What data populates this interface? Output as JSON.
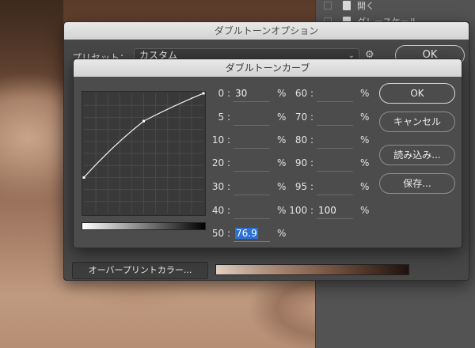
{
  "side_panel": {
    "rows": [
      {
        "label": "開く"
      },
      {
        "label": "グレースケール"
      }
    ]
  },
  "outer_dialog": {
    "title": "ダブルトーンオプション",
    "preset_label": "プリセット：",
    "preset_value": "カスタム",
    "ok_label": "OK",
    "overprint_label": "オーバープリントカラー..."
  },
  "curve_dialog": {
    "title": "ダブルトーンカーブ",
    "fields_left": [
      {
        "label": "0 :",
        "value": "30"
      },
      {
        "label": "5 :",
        "value": ""
      },
      {
        "label": "10 :",
        "value": ""
      },
      {
        "label": "20 :",
        "value": ""
      },
      {
        "label": "30 :",
        "value": ""
      },
      {
        "label": "40 :",
        "value": ""
      },
      {
        "label": "50 :",
        "value": "76.9"
      }
    ],
    "fields_right": [
      {
        "label": "60 :",
        "value": ""
      },
      {
        "label": "70 :",
        "value": ""
      },
      {
        "label": "80 :",
        "value": ""
      },
      {
        "label": "90 :",
        "value": ""
      },
      {
        "label": "95 :",
        "value": ""
      },
      {
        "label": "100 :",
        "value": "100"
      }
    ],
    "percent_symbol": "%",
    "buttons": {
      "ok": "OK",
      "cancel": "キャンセル",
      "load": "読み込み...",
      "save": "保存..."
    },
    "curve_points": [
      {
        "input": 0,
        "output": 30
      },
      {
        "input": 50,
        "output": 76.9
      },
      {
        "input": 100,
        "output": 100
      }
    ]
  },
  "colors": {
    "dialog_bg": "#474747",
    "accent_selection": "#2d6fd6"
  }
}
